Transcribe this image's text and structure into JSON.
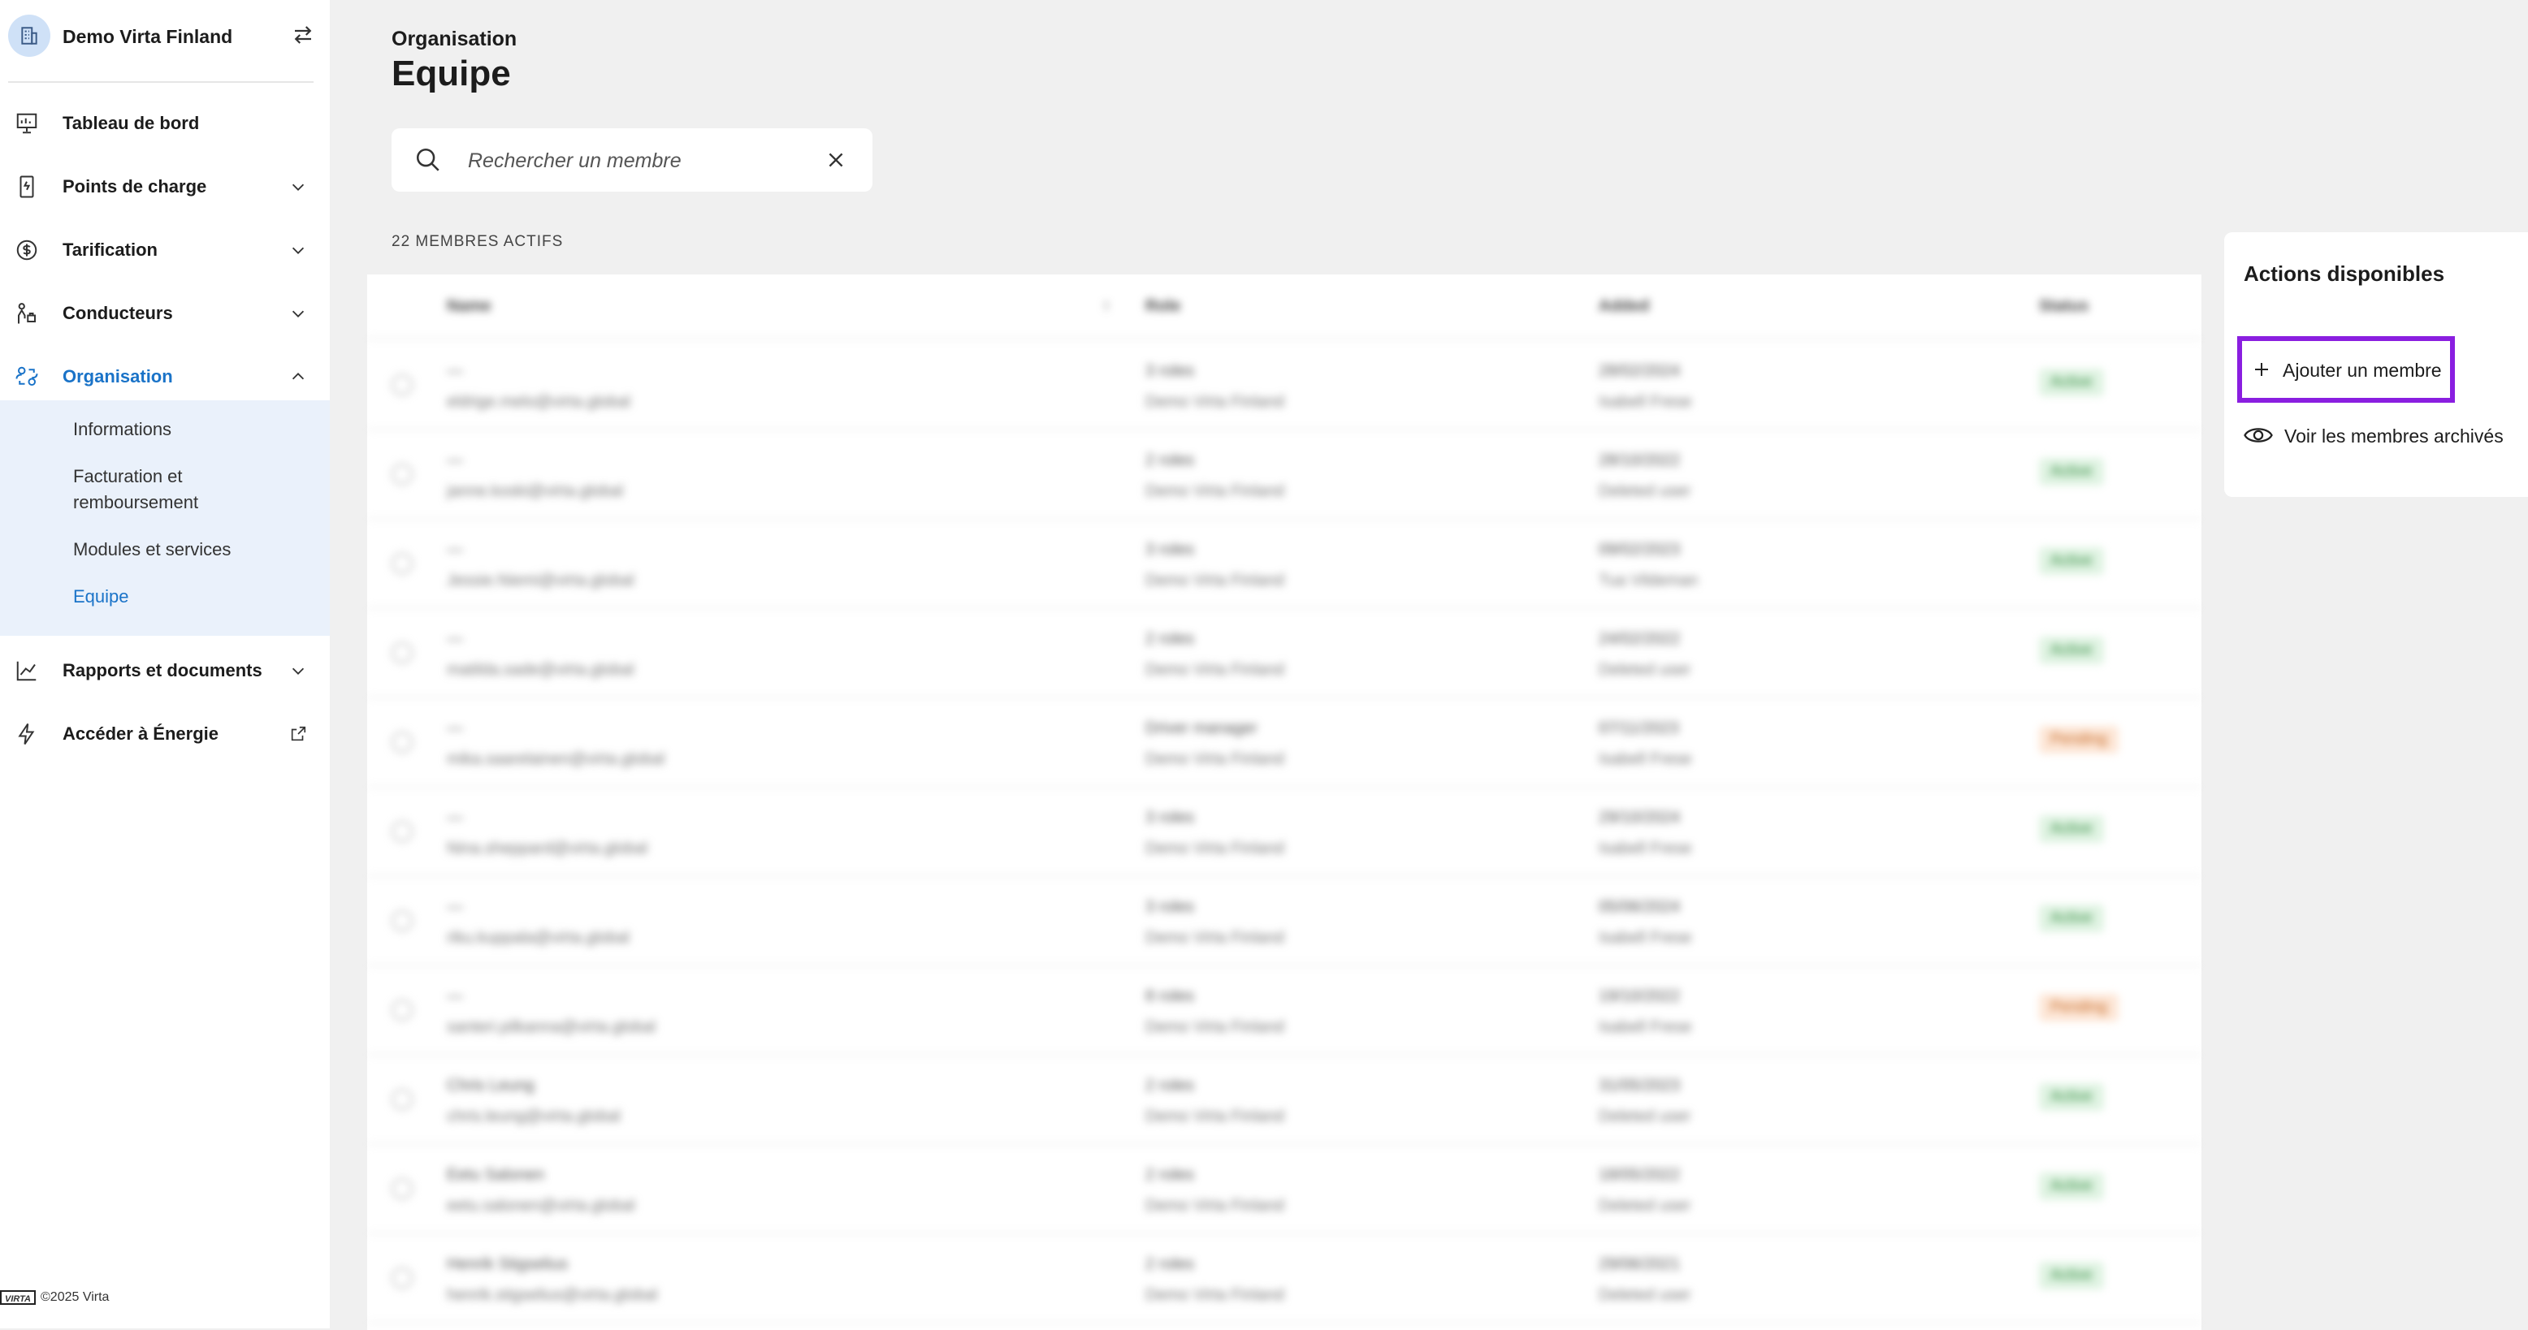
{
  "sidebar": {
    "org_name": "Demo Virta Finland",
    "nav": [
      {
        "label": "Tableau de bord",
        "icon": "dashboard-icon"
      },
      {
        "label": "Points de charge",
        "icon": "charger-icon"
      },
      {
        "label": "Tarification",
        "icon": "dollar-icon"
      },
      {
        "label": "Conducteurs",
        "icon": "drivers-icon"
      },
      {
        "label": "Organisation",
        "icon": "organisation-icon"
      },
      {
        "label": "Rapports et documents",
        "icon": "chart-icon"
      },
      {
        "label": "Accéder à Énergie",
        "icon": "lightning-icon"
      }
    ],
    "sub_items": [
      {
        "label": "Informations"
      },
      {
        "label": "Facturation et remboursement"
      },
      {
        "label": "Modules et services"
      },
      {
        "label": "Equipe"
      }
    ],
    "footer": {
      "logo_text": "VIRTA",
      "copyright": "©2025 Virta"
    }
  },
  "header": {
    "breadcrumb": "Organisation",
    "title": "Equipe"
  },
  "search": {
    "placeholder": "Rechercher un membre"
  },
  "members": {
    "count_label": "22 MEMBRES ACTIFS",
    "columns": [
      "Name",
      "Role",
      "Added",
      "Status"
    ],
    "rows": [
      {
        "name": "—",
        "email": "eldrige.melo@virta.global",
        "role": "3 roles",
        "org": "Demo Virta Finland",
        "added": "28/02/2024",
        "by": "Isabell Frese",
        "status": "Active"
      },
      {
        "name": "—",
        "email": "janne.koski@virta.global",
        "role": "2 roles",
        "org": "Demo Virta Finland",
        "added": "28/10/2022",
        "by": "Deleted user",
        "status": "Active"
      },
      {
        "name": "—",
        "email": "Jessie.Niemi@virta.global",
        "role": "3 roles",
        "org": "Demo Virta Finland",
        "added": "09/02/2023",
        "by": "Tua Vildeman",
        "status": "Active"
      },
      {
        "name": "—",
        "email": "matilda.sade@virta.global",
        "role": "2 roles",
        "org": "Demo Virta Finland",
        "added": "24/02/2022",
        "by": "Deleted user",
        "status": "Active"
      },
      {
        "name": "—",
        "email": "mika.saarelainen@virta.global",
        "role": "Driver manager",
        "org": "Demo Virta Finland",
        "added": "07/11/2023",
        "by": "Isabell Frese",
        "status": "Pending"
      },
      {
        "name": "—",
        "email": "Nina.sheppard@virta.global",
        "role": "3 roles",
        "org": "Demo Virta Finland",
        "added": "29/10/2024",
        "by": "Isabell Frese",
        "status": "Active"
      },
      {
        "name": "—",
        "email": "riku.kuppala@virta.global",
        "role": "3 roles",
        "org": "Demo Virta Finland",
        "added": "05/06/2024",
        "by": "Isabell Frese",
        "status": "Active"
      },
      {
        "name": "—",
        "email": "santeri.pilkanna@virta.global",
        "role": "8 roles",
        "org": "Demo Virta Finland",
        "added": "19/10/2022",
        "by": "Isabell Frese",
        "status": "Pending"
      },
      {
        "name": "Chris Leung",
        "email": "chris.leung@virta.global",
        "role": "2 roles",
        "org": "Demo Virta Finland",
        "added": "31/05/2023",
        "by": "Deleted user",
        "status": "Active"
      },
      {
        "name": "Eetu Salonen",
        "email": "eetu.salonen@virta.global",
        "role": "2 roles",
        "org": "Demo Virta Finland",
        "added": "18/05/2022",
        "by": "Deleted user",
        "status": "Active"
      },
      {
        "name": "Henrik Stigselius",
        "email": "henrik.stigselius@virta.global",
        "role": "2 roles",
        "org": "Demo Virta Finland",
        "added": "29/06/2021",
        "by": "Deleted user",
        "status": "Active"
      }
    ]
  },
  "actions": {
    "title": "Actions disponibles",
    "add_member": "Ajouter un membre",
    "view_archived": "Voir les membres archivés"
  },
  "colors": {
    "accent": "#1a73c8",
    "highlight": "#8a1ee0"
  }
}
